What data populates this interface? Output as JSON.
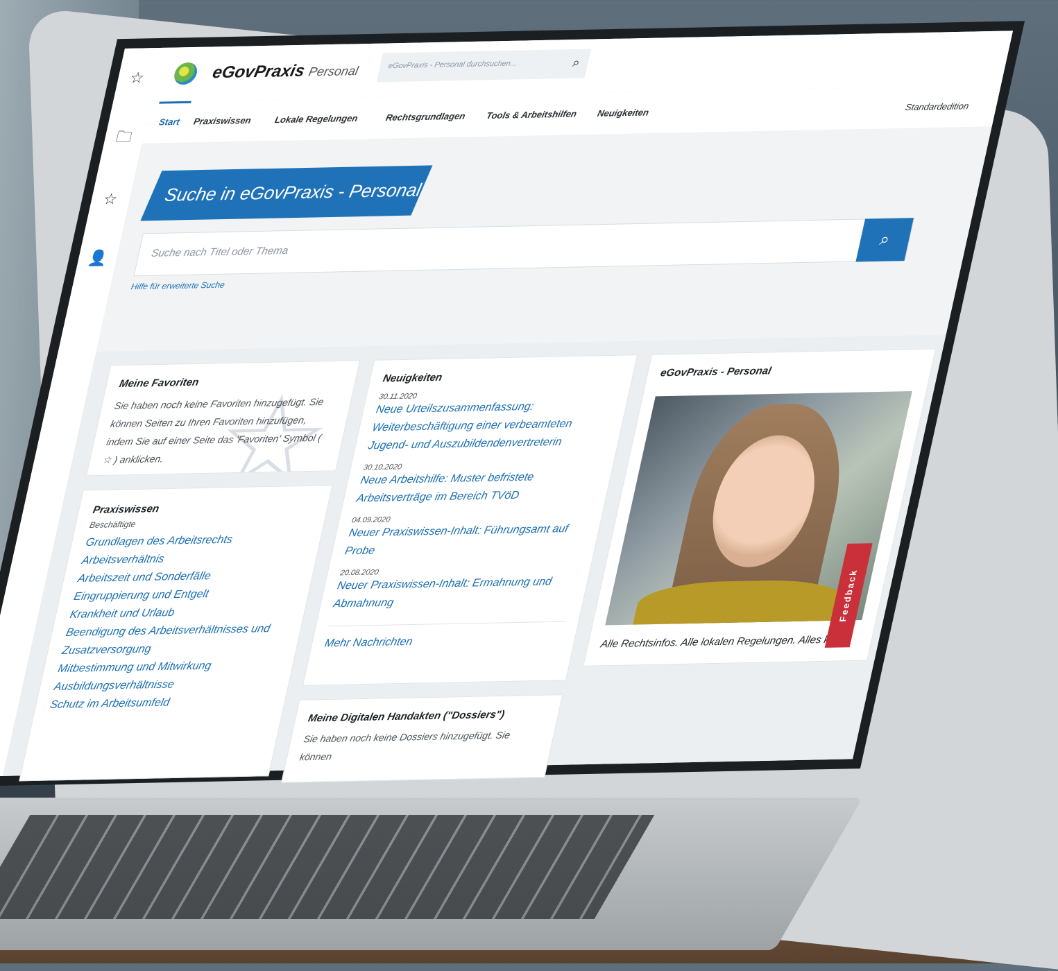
{
  "app": {
    "brand": "eGovPraxis",
    "brand_sub": "Personal",
    "top_search_placeholder": "eGovPraxis - Personal durchsuchen..."
  },
  "nav": {
    "items": [
      "Start",
      "Praxiswissen",
      "Lokale Regelungen",
      "Rechtsgrundlagen",
      "Tools & Arbeitshilfen",
      "Neuigkeiten"
    ],
    "right": "Standardedition"
  },
  "search": {
    "tab_title": "Suche in eGovPraxis - Personal",
    "placeholder": "Suche nach Titel oder Thema",
    "help": "Hilfe für erweiterte Suche"
  },
  "favorites": {
    "title": "Meine Favoriten",
    "text": "Sie haben noch keine Favoriten hinzugefügt. Sie können Seiten zu Ihren Favoriten hinzufügen, indem Sie auf einer Seite das 'Favoriten' Symbol ( ☆ ) anklicken."
  },
  "praxiswissen": {
    "title": "Praxiswissen",
    "subtitle": "Beschäftigte",
    "links": [
      "Grundlagen des Arbeitsrechts",
      "Arbeitsverhältnis",
      "Arbeitszeit und Sonderfälle",
      "Eingruppierung und Entgelt",
      "Krankheit und Urlaub",
      "Beendigung des Arbeitsverhältnisses und Zusatzversorgung",
      "Mitbestimmung und Mitwirkung",
      "Ausbildungsverhältnisse",
      "Schutz im Arbeitsumfeld"
    ]
  },
  "news": {
    "title": "Neuigkeiten",
    "items": [
      {
        "date": "30.11.2020",
        "text": "Neue Urteilszusammenfassung: Weiterbeschäftigung einer verbeamteten Jugend- und Auszubildendenvertreterin"
      },
      {
        "date": "30.10.2020",
        "text": "Neue Arbeitshilfe: Muster befristete Arbeitsverträge im Bereich TVöD"
      },
      {
        "date": "04.09.2020",
        "text": "Neuer Praxiswissen-Inhalt: Führungsamt auf Probe"
      },
      {
        "date": "20.08.2020",
        "text": "Neuer Praxiswissen-Inhalt: Ermahnung und Abmahnung"
      }
    ],
    "more": "Mehr Nachrichten"
  },
  "dossiers": {
    "title": "Meine Digitalen Handakten (\"Dossiers\")",
    "text": "Sie haben noch keine Dossiers hinzugefügt. Sie können"
  },
  "promo": {
    "title": "eGovPraxis - Personal",
    "caption": "Alle Rechtsinfos. Alle lokalen Regelungen. Alles klar."
  },
  "feedback": "Feedback",
  "icons": {
    "star": "☆",
    "folder": "🗀",
    "user": "👤",
    "search": "⌕"
  }
}
